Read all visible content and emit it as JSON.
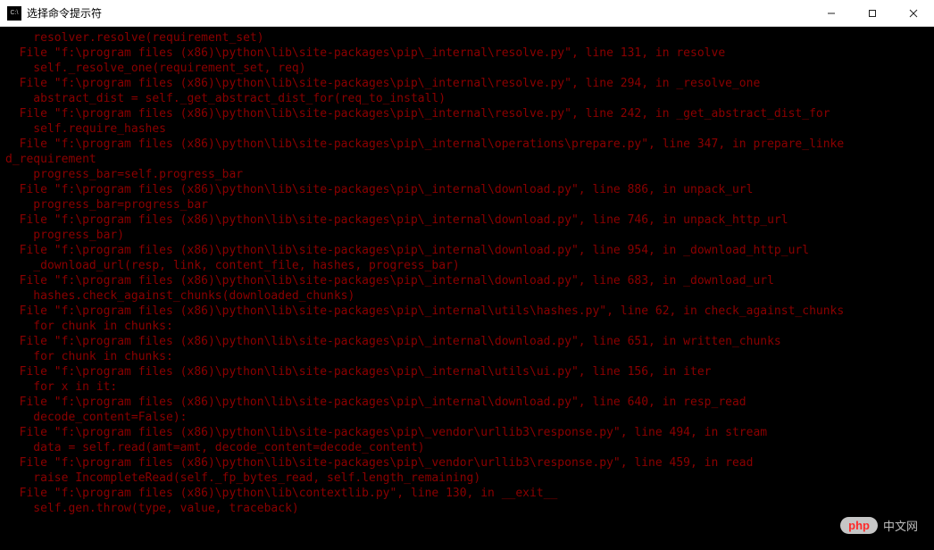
{
  "window": {
    "title": "选择命令提示符"
  },
  "controls": {
    "minimize": "—",
    "maximize": "□",
    "close": "✕"
  },
  "terminal": {
    "lines": [
      "    resolver.resolve(requirement_set)",
      "  File \"f:\\program files (x86)\\python\\lib\\site-packages\\pip\\_internal\\resolve.py\", line 131, in resolve",
      "    self._resolve_one(requirement_set, req)",
      "  File \"f:\\program files (x86)\\python\\lib\\site-packages\\pip\\_internal\\resolve.py\", line 294, in _resolve_one",
      "    abstract_dist = self._get_abstract_dist_for(req_to_install)",
      "  File \"f:\\program files (x86)\\python\\lib\\site-packages\\pip\\_internal\\resolve.py\", line 242, in _get_abstract_dist_for",
      "    self.require_hashes",
      "  File \"f:\\program files (x86)\\python\\lib\\site-packages\\pip\\_internal\\operations\\prepare.py\", line 347, in prepare_linke",
      "d_requirement",
      "    progress_bar=self.progress_bar",
      "  File \"f:\\program files (x86)\\python\\lib\\site-packages\\pip\\_internal\\download.py\", line 886, in unpack_url",
      "    progress_bar=progress_bar",
      "  File \"f:\\program files (x86)\\python\\lib\\site-packages\\pip\\_internal\\download.py\", line 746, in unpack_http_url",
      "    progress_bar)",
      "  File \"f:\\program files (x86)\\python\\lib\\site-packages\\pip\\_internal\\download.py\", line 954, in _download_http_url",
      "    _download_url(resp, link, content_file, hashes, progress_bar)",
      "  File \"f:\\program files (x86)\\python\\lib\\site-packages\\pip\\_internal\\download.py\", line 683, in _download_url",
      "    hashes.check_against_chunks(downloaded_chunks)",
      "  File \"f:\\program files (x86)\\python\\lib\\site-packages\\pip\\_internal\\utils\\hashes.py\", line 62, in check_against_chunks",
      "",
      "    for chunk in chunks:",
      "  File \"f:\\program files (x86)\\python\\lib\\site-packages\\pip\\_internal\\download.py\", line 651, in written_chunks",
      "    for chunk in chunks:",
      "  File \"f:\\program files (x86)\\python\\lib\\site-packages\\pip\\_internal\\utils\\ui.py\", line 156, in iter",
      "    for x in it:",
      "  File \"f:\\program files (x86)\\python\\lib\\site-packages\\pip\\_internal\\download.py\", line 640, in resp_read",
      "    decode_content=False):",
      "  File \"f:\\program files (x86)\\python\\lib\\site-packages\\pip\\_vendor\\urllib3\\response.py\", line 494, in stream",
      "    data = self.read(amt=amt, decode_content=decode_content)",
      "  File \"f:\\program files (x86)\\python\\lib\\site-packages\\pip\\_vendor\\urllib3\\response.py\", line 459, in read",
      "    raise IncompleteRead(self._fp_bytes_read, self.length_remaining)",
      "  File \"f:\\program files (x86)\\python\\lib\\contextlib.py\", line 130, in __exit__",
      "    self.gen.throw(type, value, traceback)"
    ]
  },
  "watermark": {
    "brand": "php",
    "text": "中文网"
  }
}
